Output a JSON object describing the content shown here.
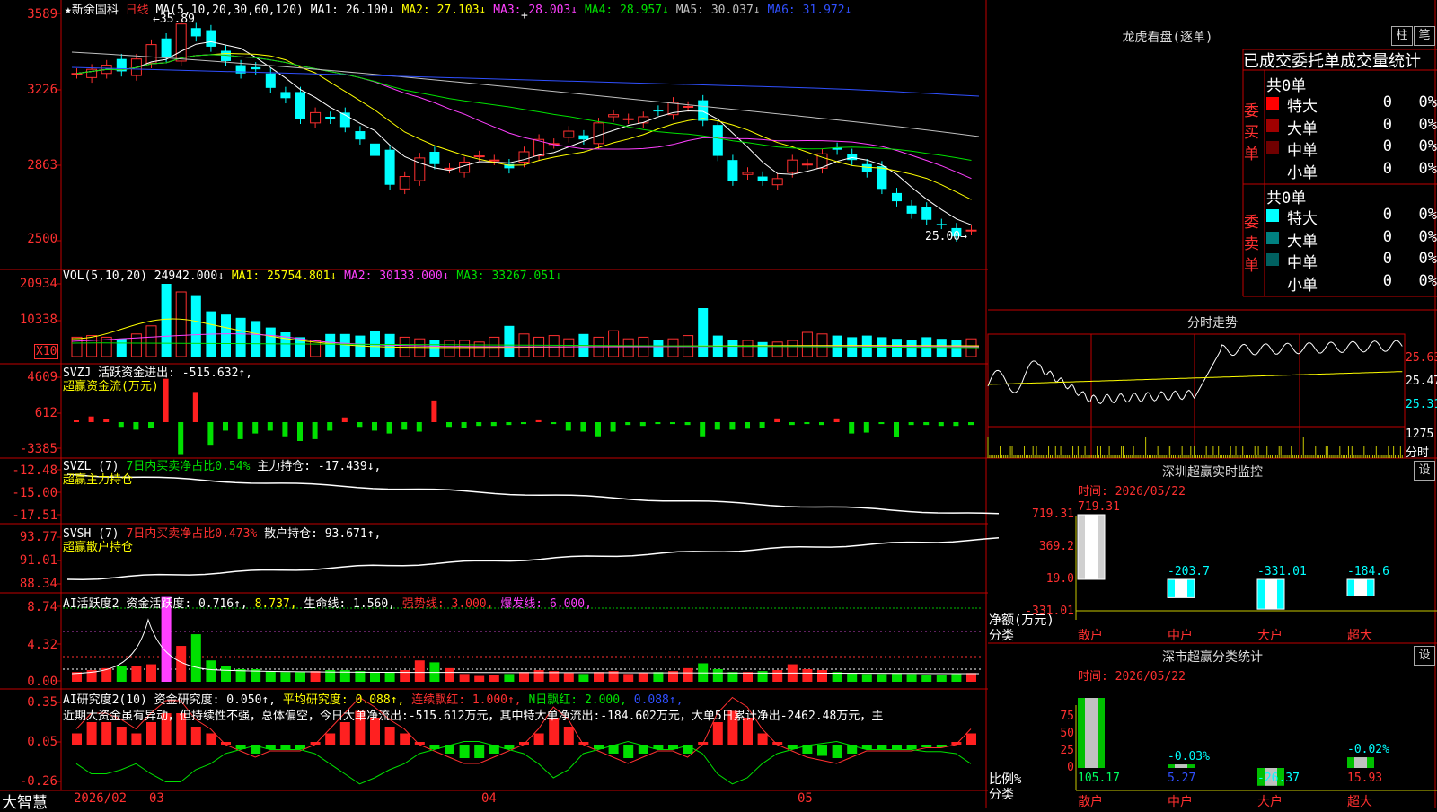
{
  "stock": {
    "star_name": "★新余国科",
    "period": "日线",
    "ma_label": "MA(5,10,20,30,60,120)",
    "ma": [
      {
        "label": "MA1:",
        "value": "26.100↓",
        "color": "#ffffff"
      },
      {
        "label": "MA2:",
        "value": "27.103↓",
        "color": "#ffff00"
      },
      {
        "label": "MA3:",
        "value": "28.003↓",
        "color": "#ff40ff"
      },
      {
        "label": "MA4:",
        "value": "28.957↓",
        "color": "#00e000"
      },
      {
        "label": "MA5:",
        "value": "30.037↓",
        "color": "#c0c0c0"
      },
      {
        "label": "MA6:",
        "value": "31.972↓",
        "color": "#3050ff"
      }
    ],
    "high_marker": "←35.89",
    "low_marker": "25.00→",
    "plus": "+"
  },
  "axes": {
    "price": [
      "3589",
      "3226",
      "2863",
      "2500"
    ],
    "vol": [
      "20934",
      "10338"
    ],
    "vol_unit": "X10",
    "svzj": [
      "4609",
      "612",
      "-3385"
    ],
    "svzl": [
      "-12.48",
      "-15.00",
      "-17.51"
    ],
    "svsh": [
      "93.77",
      "91.01",
      "88.34"
    ],
    "ai": [
      "8.74",
      "4.32",
      "0.00"
    ],
    "ai2": [
      "0.35",
      "0.05",
      "-0.26"
    ]
  },
  "vol_header": {
    "label": "VOL(5,10,20)",
    "value": "24942.000↓",
    "items": [
      {
        "label": "MA1:",
        "value": "25754.801↓",
        "color": "#ffff00"
      },
      {
        "label": "MA2:",
        "value": "30133.000↓",
        "color": "#ff40ff"
      },
      {
        "label": "MA3:",
        "value": "33267.051↓",
        "color": "#00e000"
      }
    ]
  },
  "svzj_header": {
    "label": "SVZJ",
    "text": "活跃资金进出:",
    "value": "-515.632↑,",
    "sub": "超赢资金流(万元)"
  },
  "svzl_header": {
    "label": "SVZL (7)",
    "text1": "7日内买卖净占比0.54%",
    "text2": "主力持仓:",
    "value": "-17.439↓,",
    "sub": "超赢主力持仓"
  },
  "svsh_header": {
    "label": "SVSH (7)",
    "text1": "7日内买卖净占比0.473%",
    "text2": "散户持仓:",
    "value": "93.671↑,",
    "sub": "超赢散户持仓"
  },
  "ai_header": {
    "label": "AI活跃度2",
    "t1": "资金活跃度:",
    "v1": "0.716↑,",
    "v2": "8.737,",
    "t3": "生命线:",
    "v3": "1.560,",
    "t4": "强势线:",
    "v4": "3.000,",
    "t5": "爆发线:",
    "v5": "6.000,"
  },
  "ai2_header": {
    "label": "AI研究度2(10)",
    "t1": "资金研究度:",
    "v1": "0.050↑,",
    "t2": "平均研究度:",
    "v2": "0.088↑,",
    "t3": "连续飘红:",
    "v3": "1.000↑,",
    "t4": "N日飘红:",
    "v4": "2.000,",
    "v5": "0.088↑,"
  },
  "comment": "近期大资金虽有异动，但持续性不强，总体偏空，今日大单净流出:-515.612万元，其中特大单净流出:-184.602万元，大单5日累计净出-2462.48万元，主",
  "bottom_bar": {
    "brand": "大智慧",
    "date": "2026/02",
    "m03": "03",
    "m04": "04",
    "m05": "05"
  },
  "right": {
    "longhu_title": "龙虎看盘(逐单)",
    "btn_zhu": "柱",
    "btn_bi": "笔",
    "order_title": "已成交委托单成交量统计",
    "buy_total": "共0单",
    "buy_side": "委买单",
    "sell_total": "共0单",
    "sell_side": "委卖单",
    "buy_rows": [
      {
        "name": "特大",
        "count": "0",
        "pct": "0%",
        "color": "#ff0000"
      },
      {
        "name": "大单",
        "count": "0",
        "pct": "0%",
        "color": "#a00000"
      },
      {
        "name": "中单",
        "count": "0",
        "pct": "0%",
        "color": "#700000"
      },
      {
        "name": "小单",
        "count": "0",
        "pct": "0%",
        "color": "#000000"
      }
    ],
    "sell_rows": [
      {
        "name": "特大",
        "count": "0",
        "pct": "0%",
        "color": "#00ffff"
      },
      {
        "name": "大单",
        "count": "0",
        "pct": "0%",
        "color": "#008080"
      },
      {
        "name": "中单",
        "count": "0",
        "pct": "0%",
        "color": "#006060"
      },
      {
        "name": "小单",
        "count": "0",
        "pct": "0%",
        "color": "#000000"
      }
    ],
    "fenshi_title": "分时走势",
    "fs_prices": [
      "25.63",
      "25.47",
      "25.31"
    ],
    "fs_vol": "1275",
    "fs_vol_label": "分时",
    "monitor_title": "深圳超赢实时监控",
    "btn_set": "设",
    "monitor_time": "时间: 2026/05/22",
    "monitor_axis": [
      "719.31",
      "369.2",
      "19.0",
      "-331.01"
    ],
    "monitor_bars": [
      {
        "cat": "散户",
        "value": 719.31,
        "label": "719.31"
      },
      {
        "cat": "中户",
        "value": -203.7,
        "label": "-203.7"
      },
      {
        "cat": "大户",
        "value": -331.01,
        "label": "-331.01"
      },
      {
        "cat": "超大",
        "value": -184.6,
        "label": "-184.6"
      }
    ],
    "monitor_ylabel": "净额(万元)",
    "monitor_xlabel": "分类",
    "stat_title": "深市超赢分类统计",
    "btn_set2": "设",
    "stat_time": "时间: 2026/05/22",
    "stat_axis": [
      "75",
      "50",
      "25",
      "0"
    ],
    "stat_bars": [
      {
        "cat": "散户",
        "value": 105.17,
        "label": "105.17"
      },
      {
        "cat": "中户",
        "value": 5.27,
        "label": "5.27",
        "top": "-0.03%"
      },
      {
        "cat": "大户",
        "value": -26.37,
        "label": "-26.37"
      },
      {
        "cat": "超大",
        "value": 15.93,
        "label": "15.93",
        "top": "-0.02%"
      }
    ],
    "stat_ylabel": "比例%",
    "stat_xlabel": "分类"
  },
  "chart_data": [
    {
      "type": "candlestick",
      "title": "新余国科 日线",
      "ylim": [
        25.0,
        35.89
      ],
      "closes": [
        33.2,
        33.4,
        33.6,
        33.3,
        33.9,
        34.6,
        34.0,
        35.6,
        35.0,
        34.5,
        33.8,
        33.2,
        33.4,
        32.5,
        32.0,
        31.0,
        31.3,
        31.0,
        30.6,
        30.0,
        29.2,
        27.8,
        28.2,
        29.1,
        28.8,
        28.6,
        28.9,
        29.2,
        29.0,
        28.6,
        29.4,
        30.0,
        29.8,
        30.4,
        30.0,
        30.8,
        31.2,
        31.0,
        31.1,
        31.4,
        31.8,
        31.6,
        30.9,
        29.2,
        28.0,
        28.4,
        28.0,
        28.1,
        29.0,
        28.8,
        29.3,
        29.5,
        29.0,
        28.4,
        27.6,
        27.0,
        26.4,
        26.1,
        25.9,
        25.3,
        25.6
      ]
    },
    {
      "type": "bar",
      "title": "VOL(5,10,20)",
      "values": [
        1.2,
        1.3,
        1.2,
        1.1,
        1.4,
        1.9,
        4.5,
        4.0,
        3.8,
        2.8,
        2.6,
        2.4,
        2.2,
        1.8,
        1.5,
        1.2,
        1.0,
        1.4,
        1.4,
        1.3,
        1.6,
        1.4,
        1.2,
        1.1,
        1.0,
        1.0,
        1.0,
        0.9,
        1.2,
        1.9,
        1.4,
        1.2,
        1.3,
        1.1,
        1.4,
        1.2,
        1.6,
        1.1,
        1.2,
        1.0,
        1.1,
        1.3,
        3.0,
        1.3,
        1.0,
        1.0,
        0.9,
        0.9,
        1.0,
        1.5,
        1.4,
        1.3,
        1.2,
        1.3,
        1.2,
        1.1,
        1.0,
        1.2,
        1.1,
        1.0,
        1.1
      ]
    },
    {
      "type": "bar",
      "title": "SVZJ",
      "values": [
        0,
        600,
        300,
        -500,
        -800,
        -600,
        4600,
        -3385,
        3200,
        -2400,
        -900,
        -1800,
        -1200,
        -900,
        -1500,
        -2000,
        -1800,
        -900,
        500,
        -500,
        -900,
        -1200,
        -800,
        -1000,
        2300,
        -500,
        -600,
        -400,
        -400,
        -300,
        -200,
        200,
        -200,
        -900,
        -1000,
        -1500,
        -1000,
        -300,
        -400,
        -200,
        -200,
        -300,
        -1500,
        -800,
        -800,
        -700,
        -600,
        400,
        -300,
        -200,
        -300,
        400,
        -1200,
        -1100,
        -200,
        -1600,
        -300,
        -300,
        -400,
        -400,
        -300
      ]
    },
    {
      "type": "line",
      "title": "SVZL",
      "ylim": [
        -17.51,
        -12.48
      ],
      "trend": [
        -12.5,
        -17.4
      ]
    },
    {
      "type": "line",
      "title": "SVSH",
      "ylim": [
        88.34,
        93.77
      ],
      "trend": [
        88.6,
        93.7
      ]
    },
    {
      "type": "bar",
      "title": "AI活跃度2",
      "ylim": [
        0,
        8.74
      ],
      "values": [
        1,
        1.2,
        1.4,
        1.6,
        1.6,
        1.8,
        8.74,
        3.7,
        4.9,
        2.2,
        1.6,
        1.3,
        1.3,
        1.1,
        1.0,
        1.0,
        1.1,
        1.2,
        1.2,
        1.1,
        1.0,
        1.0,
        1.2,
        2.2,
        2.0,
        1.4,
        0.8,
        0.6,
        0.7,
        0.8,
        1.0,
        1.2,
        1.1,
        0.9,
        0.8,
        1.0,
        1.1,
        0.8,
        0.9,
        1.0,
        1.1,
        1.4,
        1.9,
        1.3,
        1.0,
        1.0,
        1.1,
        1.2,
        1.8,
        1.3,
        1.2,
        1.0,
        0.9,
        0.8,
        0.8,
        0.9,
        0.8,
        0.7,
        0.7,
        0.8,
        0.9
      ]
    },
    {
      "type": "bar",
      "title": "AI研究度2(10)",
      "ylim": [
        -0.26,
        0.35
      ],
      "values": [
        0.05,
        0.1,
        0.1,
        0.08,
        0.05,
        0.1,
        0.14,
        0.14,
        0.08,
        0.05,
        0.0,
        -0.02,
        -0.04,
        -0.02,
        -0.02,
        -0.02,
        0.0,
        0.05,
        0.1,
        0.15,
        0.12,
        0.08,
        0.05,
        0.0,
        -0.02,
        -0.04,
        -0.06,
        -0.06,
        -0.04,
        -0.02,
        0.0,
        0.05,
        0.12,
        0.08,
        0.0,
        -0.02,
        -0.04,
        -0.06,
        -0.04,
        -0.02,
        -0.02,
        -0.04,
        0.0,
        0.1,
        0.15,
        0.12,
        0.05,
        0.0,
        -0.02,
        -0.04,
        -0.05,
        -0.06,
        -0.04,
        -0.02,
        -0.02,
        -0.02,
        -0.02,
        -0.01,
        -0.01,
        0.0,
        0.05
      ]
    }
  ]
}
